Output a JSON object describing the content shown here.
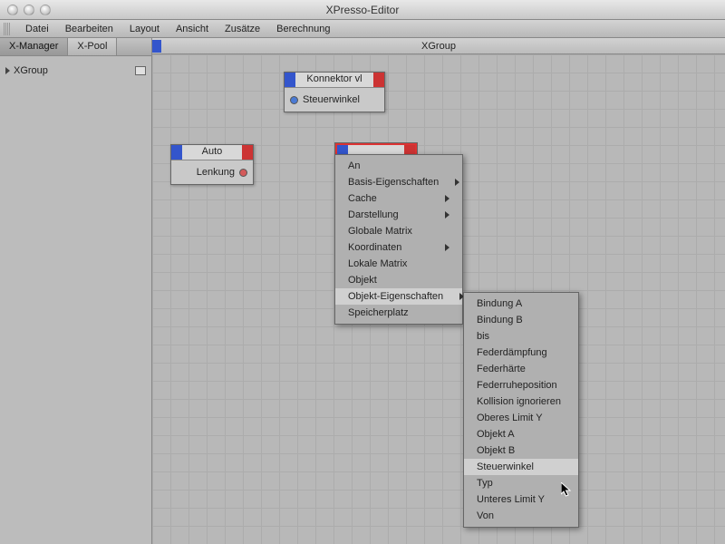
{
  "window": {
    "title": "XPresso-Editor"
  },
  "menubar": [
    "Datei",
    "Bearbeiten",
    "Layout",
    "Ansicht",
    "Zusätze",
    "Berechnung"
  ],
  "sidebar": {
    "tabs": [
      "X-Manager",
      "X-Pool"
    ],
    "active_tab": 0,
    "tree": {
      "root": "XGroup"
    }
  },
  "canvas": {
    "title": "XGroup"
  },
  "nodes": [
    {
      "title": "Konnektor vl",
      "ports_in": [
        "Steuerwinkel"
      ]
    },
    {
      "title": "Auto",
      "ports_out": [
        "Lenkung"
      ]
    },
    {
      "title": ""
    }
  ],
  "context_menu_1": [
    {
      "label": "An",
      "submenu": false
    },
    {
      "label": "Basis-Eigenschaften",
      "submenu": true
    },
    {
      "label": "Cache",
      "submenu": true
    },
    {
      "label": "Darstellung",
      "submenu": true
    },
    {
      "label": "Globale Matrix",
      "submenu": false
    },
    {
      "label": "Koordinaten",
      "submenu": true
    },
    {
      "label": "Lokale Matrix",
      "submenu": false
    },
    {
      "label": "Objekt",
      "submenu": false
    },
    {
      "label": "Objekt-Eigenschaften",
      "submenu": true,
      "hover": true
    },
    {
      "label": "Speicherplatz",
      "submenu": false
    }
  ],
  "context_menu_2": [
    "Bindung A",
    "Bindung B",
    "bis",
    "Federdämpfung",
    "Federhärte",
    "Federruheposition",
    "Kollision ignorieren",
    "Oberes Limit Y",
    "Objekt A",
    "Objekt B",
    "Steuerwinkel",
    "Typ",
    "Unteres Limit Y",
    "Von"
  ],
  "context_menu_2_hover_index": 10
}
